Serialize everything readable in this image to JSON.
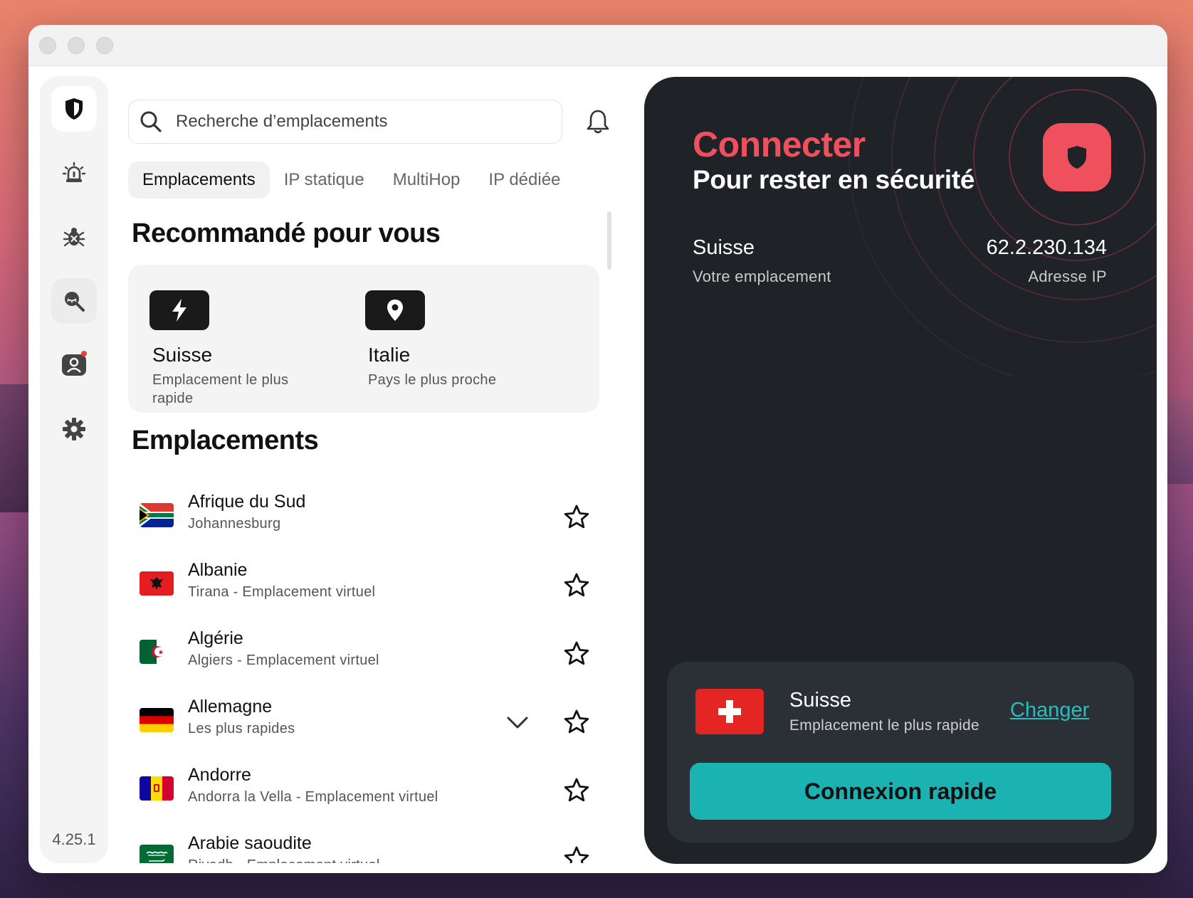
{
  "window": {
    "traffic_lights": [
      "close",
      "minimize",
      "zoom"
    ]
  },
  "sidebar": {
    "items": [
      {
        "icon": "shield-icon",
        "active": true
      },
      {
        "icon": "alarm-icon"
      },
      {
        "icon": "bug-icon"
      },
      {
        "icon": "search-eye-icon"
      },
      {
        "icon": "account-icon",
        "badge": true
      },
      {
        "icon": "gear-icon"
      }
    ],
    "version": "4.25.1"
  },
  "search": {
    "placeholder": "Recherche d’emplacements",
    "value": ""
  },
  "tabs": [
    {
      "label": "Emplacements",
      "active": true
    },
    {
      "label": "IP statique"
    },
    {
      "label": "MultiHop"
    },
    {
      "label": "IP dédiée"
    }
  ],
  "recommended": {
    "heading": "Recommandé pour vous",
    "items": [
      {
        "icon": "lightning-icon",
        "title": "Suisse",
        "subtitle": "Emplacement le plus rapide"
      },
      {
        "icon": "location-pin-icon",
        "title": "Italie",
        "subtitle": "Pays le plus proche"
      }
    ]
  },
  "locations": {
    "heading": "Emplacements",
    "items": [
      {
        "name": "Afrique du Sud",
        "sub": "Johannesburg",
        "flag": "za"
      },
      {
        "name": "Albanie",
        "sub": "Tirana - Emplacement virtuel",
        "flag": "al"
      },
      {
        "name": "Algérie",
        "sub": "Algiers - Emplacement virtuel",
        "flag": "dz"
      },
      {
        "name": "Allemagne",
        "sub": "Les plus rapides",
        "flag": "de",
        "expandable": true
      },
      {
        "name": "Andorre",
        "sub": "Andorra la Vella - Emplacement virtuel",
        "flag": "ad"
      },
      {
        "name": "Arabie saoudite",
        "sub": "Riyadh - Emplacement virtuel",
        "flag": "sa"
      }
    ]
  },
  "status": {
    "title": "Connecter",
    "subtitle": "Pour rester en sécurité",
    "location": "Suisse",
    "location_caption": "Votre emplacement",
    "ip": "62.2.230.134",
    "ip_caption": "Adresse IP"
  },
  "quick_connect": {
    "country": "Suisse",
    "subtitle": "Emplacement le plus rapide",
    "change_label": "Changer",
    "button_label": "Connexion rapide"
  },
  "colors": {
    "accent_red": "#f0505e",
    "accent_teal": "#1bb2b2",
    "panel_dark": "#1f2328"
  }
}
